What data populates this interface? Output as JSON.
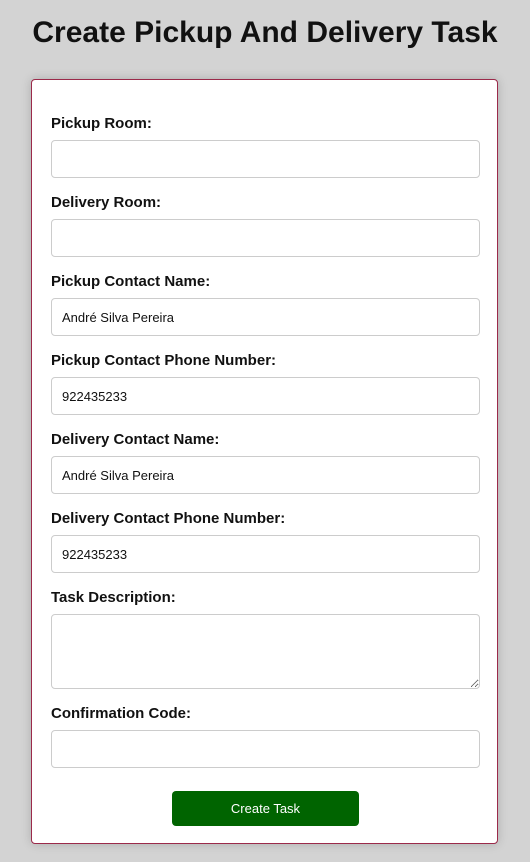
{
  "page": {
    "title": "Create Pickup And Delivery Task"
  },
  "form": {
    "pickup_room": {
      "label": "Pickup Room:",
      "value": ""
    },
    "delivery_room": {
      "label": "Delivery Room:",
      "value": ""
    },
    "pickup_contact_name": {
      "label": "Pickup Contact Name:",
      "value": "André Silva Pereira"
    },
    "pickup_contact_phone": {
      "label": "Pickup Contact Phone Number:",
      "value": "922435233"
    },
    "delivery_contact_name": {
      "label": "Delivery Contact Name:",
      "value": "André Silva Pereira"
    },
    "delivery_contact_phone": {
      "label": "Delivery Contact Phone Number:",
      "value": "922435233"
    },
    "task_description": {
      "label": "Task Description:",
      "value": ""
    },
    "confirmation_code": {
      "label": "Confirmation Code:",
      "value": ""
    },
    "submit_label": "Create Task"
  },
  "colors": {
    "background": "#d3d3d3",
    "card_border": "#9b2a4a",
    "button": "#006400",
    "button_text": "#ffffff"
  }
}
